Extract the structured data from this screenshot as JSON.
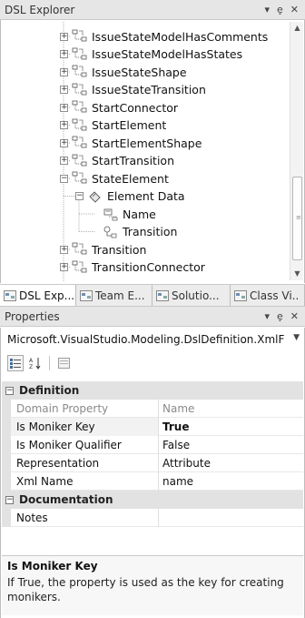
{
  "dsl_explorer": {
    "title": "DSL Explorer",
    "controls": [
      "▾",
      "ȩ",
      "✕"
    ],
    "tree": [
      {
        "label": "IssueStateModelHasComments",
        "expander": "+",
        "icon": "relationship-icon"
      },
      {
        "label": "IssueStateModelHasStates",
        "expander": "+",
        "icon": "relationship-icon"
      },
      {
        "label": "IssueStateShape",
        "expander": "+",
        "icon": "relationship-icon"
      },
      {
        "label": "IssueStateTransition",
        "expander": "+",
        "icon": "relationship-icon"
      },
      {
        "label": "StartConnector",
        "expander": "+",
        "icon": "relationship-icon"
      },
      {
        "label": "StartElement",
        "expander": "+",
        "icon": "relationship-icon"
      },
      {
        "label": "StartElementShape",
        "expander": "+",
        "icon": "relationship-icon"
      },
      {
        "label": "StartTransition",
        "expander": "+",
        "icon": "relationship-icon"
      },
      {
        "label": "StateElement",
        "expander": "−",
        "icon": "relationship-icon"
      },
      {
        "label": "Element Data",
        "expander": "−",
        "icon": "element-data-icon"
      },
      {
        "label": "Name",
        "expander": "",
        "icon": "property-icon"
      },
      {
        "label": "Transition",
        "expander": "",
        "icon": "role-icon"
      },
      {
        "label": "Transition",
        "expander": "+",
        "icon": "relationship-icon"
      },
      {
        "label": "TransitionConnector",
        "expander": "+",
        "icon": "relationship-icon"
      }
    ]
  },
  "tabs": [
    {
      "label": "DSL Exp...",
      "icon": "dsl-explorer-icon",
      "active": true
    },
    {
      "label": "Team E...",
      "icon": "team-explorer-icon",
      "active": false
    },
    {
      "label": "Solutio...",
      "icon": "solution-explorer-icon",
      "active": false
    },
    {
      "label": "Class Vi..",
      "icon": "class-view-icon",
      "active": false
    }
  ],
  "properties": {
    "title": "Properties",
    "controls": [
      "▾",
      "ȩ",
      "✕"
    ],
    "object_selector": "Microsoft.VisualStudio.Modeling.DslDefinition.XmlF",
    "categories": [
      {
        "name": "Definition",
        "expander": "−",
        "rows": [
          {
            "name": "Domain Property",
            "value": "Name",
            "readonly": true,
            "bold": false
          },
          {
            "name": "Is Moniker Key",
            "value": "True",
            "readonly": false,
            "bold": true,
            "selected": true
          },
          {
            "name": "Is Moniker Qualifier",
            "value": "False",
            "readonly": false,
            "bold": false
          },
          {
            "name": "Representation",
            "value": "Attribute",
            "readonly": false,
            "bold": false
          },
          {
            "name": "Xml Name",
            "value": "name",
            "readonly": false,
            "bold": false
          }
        ]
      },
      {
        "name": "Documentation",
        "expander": "−",
        "rows": [
          {
            "name": "Notes",
            "value": "",
            "readonly": false,
            "bold": false
          }
        ]
      }
    ],
    "description": {
      "title": "Is Moniker Key",
      "text": "If True, the property is used as the key for creating monikers."
    }
  },
  "colors": {
    "titlebar_bg": "#e6e6e6",
    "category_bg": "#e2e2e2",
    "readonly_text": "#8a8a8a"
  }
}
